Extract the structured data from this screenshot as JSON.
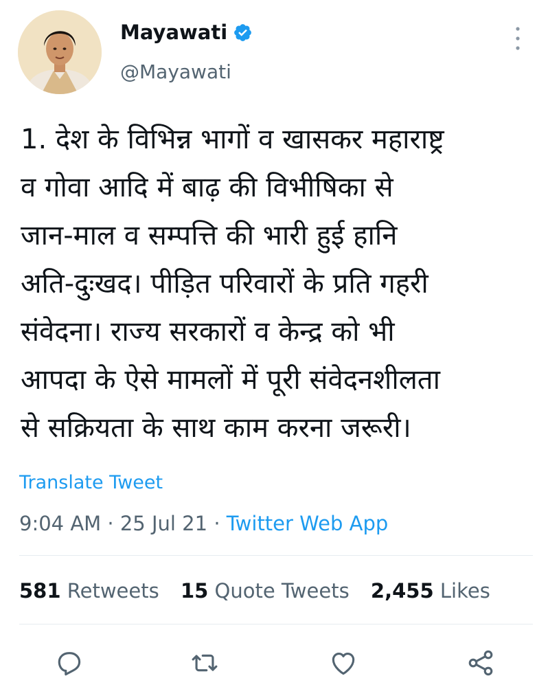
{
  "user": {
    "name": "Mayawati",
    "handle": "@Mayawati",
    "verified": true
  },
  "tweet": {
    "text": "1. देश के विभिन्न भागों व खासकर महाराष्ट्र\nव गोवा आदि में बाढ़ की विभीषिका से\nजान-माल व सम्पत्ति की भारी हुई हानि\nअति-दुःखद। पीड़ित परिवारों के प्रति गहरी\nसंवेदना। राज्य सरकारों व केन्द्र को भी\nआपदा के ऐसे मामलों में पूरी संवेदनशीलता\nसे सक्रियता के साथ काम करना जरूरी।",
    "translate_label": "Translate Tweet",
    "time": "9:04 AM",
    "date": "25 Jul 21",
    "source": "Twitter Web App",
    "separator": "·"
  },
  "stats": {
    "retweets_count": "581",
    "retweets_label": "Retweets",
    "quotes_count": "15",
    "quotes_label": "Quote Tweets",
    "likes_count": "2,455",
    "likes_label": "Likes"
  },
  "colors": {
    "accent": "#1d9bf0",
    "secondary_text": "#536471",
    "primary_text": "#0f1419"
  },
  "icons": [
    "verified-badge-icon",
    "more-options-icon",
    "reply-icon",
    "retweet-icon",
    "like-icon",
    "share-icon"
  ]
}
